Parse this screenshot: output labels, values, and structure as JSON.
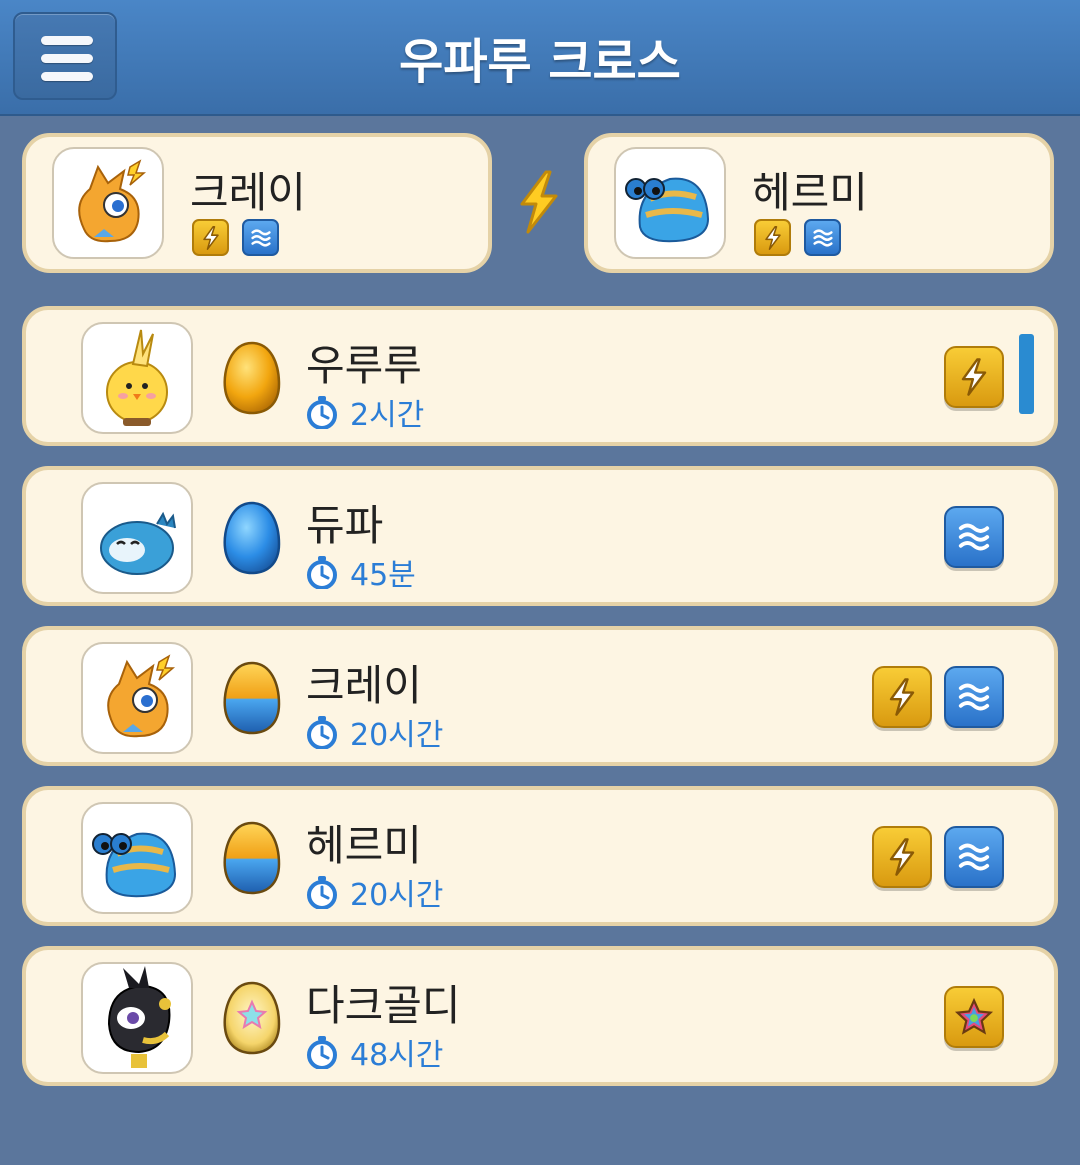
{
  "header": {
    "title": "우파루 크로스",
    "menu_icon": "hamburger-menu-icon"
  },
  "parents": [
    {
      "name": "크레이",
      "elements": [
        "electric",
        "water"
      ]
    },
    {
      "name": "헤르미",
      "elements": [
        "electric",
        "water"
      ]
    }
  ],
  "cross_icon": "lightning-icon",
  "results": [
    {
      "name": "우루루",
      "time": "2시간",
      "egg": "yellow",
      "elements": [
        "electric"
      ]
    },
    {
      "name": "듀파",
      "time": "45분",
      "egg": "blue",
      "elements": [
        "water"
      ]
    },
    {
      "name": "크레이",
      "time": "20시간",
      "egg": "yellow-blue",
      "elements": [
        "electric",
        "water"
      ]
    },
    {
      "name": "헤르미",
      "time": "20시간",
      "egg": "yellow-blue",
      "elements": [
        "electric",
        "water"
      ]
    },
    {
      "name": "다크골디",
      "time": "48시간",
      "egg": "rainbow",
      "elements": [
        "star"
      ]
    }
  ],
  "colors": {
    "background": "#5b769c",
    "header": "#4a86c7",
    "card": "#fdf5e3",
    "card_border": "#e5d2a7",
    "time_text": "#2b7dd6",
    "electric": "#f2b824",
    "water": "#3b8ee0"
  }
}
